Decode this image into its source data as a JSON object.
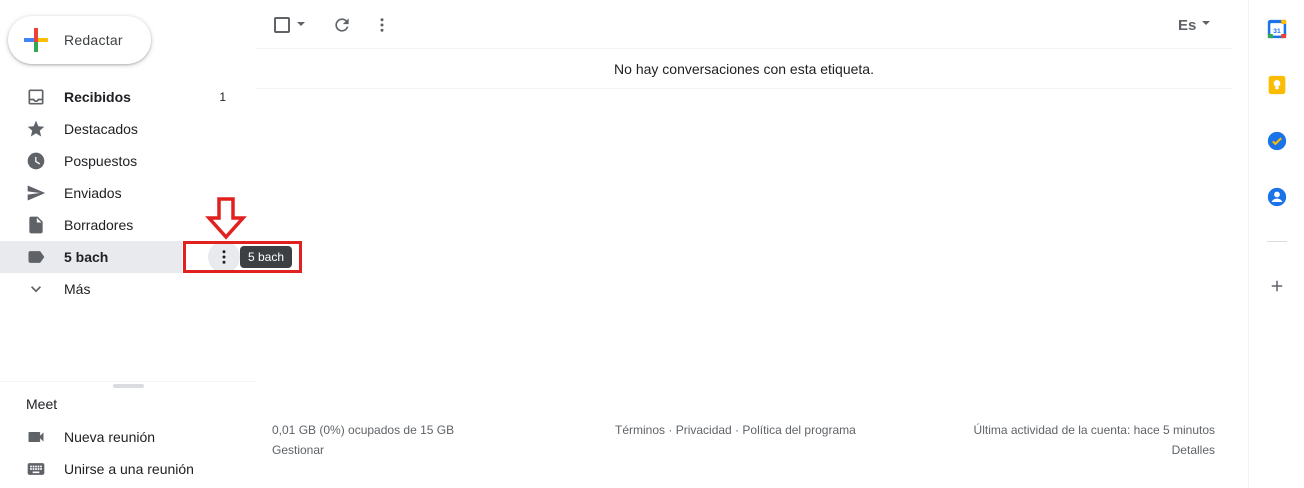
{
  "compose": {
    "label": "Redactar"
  },
  "nav": {
    "items": [
      {
        "label": "Recibidos",
        "count": "1",
        "icon": "inbox-icon"
      },
      {
        "label": "Destacados",
        "icon": "star-icon"
      },
      {
        "label": "Pospuestos",
        "icon": "clock-icon"
      },
      {
        "label": "Enviados",
        "icon": "send-icon"
      },
      {
        "label": "Borradores",
        "icon": "draft-icon"
      },
      {
        "label": "5 bach",
        "icon": "label-icon"
      },
      {
        "label": "Más",
        "icon": "chevron-down-icon"
      }
    ],
    "tooltip": "5 bach"
  },
  "meet": {
    "title": "Meet",
    "items": [
      {
        "label": "Nueva reunión",
        "icon": "video-icon"
      },
      {
        "label": "Unirse a una reunión",
        "icon": "keyboard-icon"
      }
    ]
  },
  "toolbar": {
    "language": "Es"
  },
  "main": {
    "empty_message": "No hay conversaciones con esta etiqueta."
  },
  "footer": {
    "storage": "0,01 GB (0%) ocupados de 15 GB",
    "manage": "Gestionar",
    "terms": "Términos",
    "privacy": "Privacidad",
    "policy": "Política del programa",
    "separator": " · ",
    "last_activity": "Última actividad de la cuenta: hace 5 minutos",
    "details": "Detalles"
  },
  "right_panel": {
    "calendar_day": "31"
  },
  "colors": {
    "highlight": "#e1211f",
    "accent_blue": "#1a73e8"
  }
}
